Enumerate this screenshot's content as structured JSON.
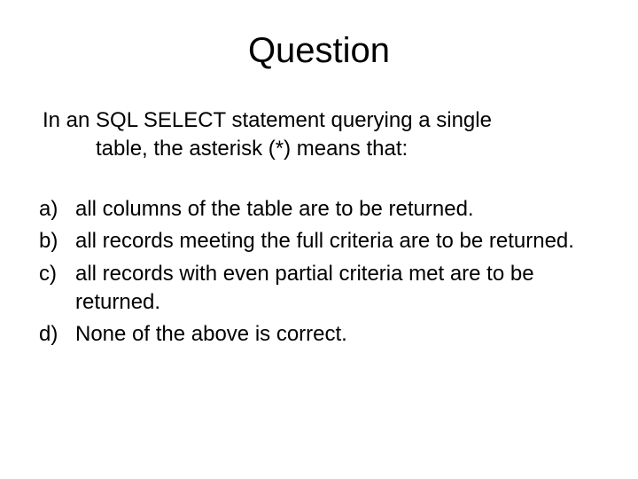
{
  "title": "Question",
  "stem_line1": "In an SQL SELECT statement querying a single",
  "stem_line2": "table, the asterisk (*) means that:",
  "options": [
    {
      "marker": "a)",
      "text": "all columns of the table are to be returned."
    },
    {
      "marker": "b)",
      "text": "all records meeting the full criteria are to be returned."
    },
    {
      "marker": "c)",
      "text": "all records with even partial criteria met are to be returned."
    },
    {
      "marker": "d)",
      "text": "None of the above is correct."
    }
  ]
}
